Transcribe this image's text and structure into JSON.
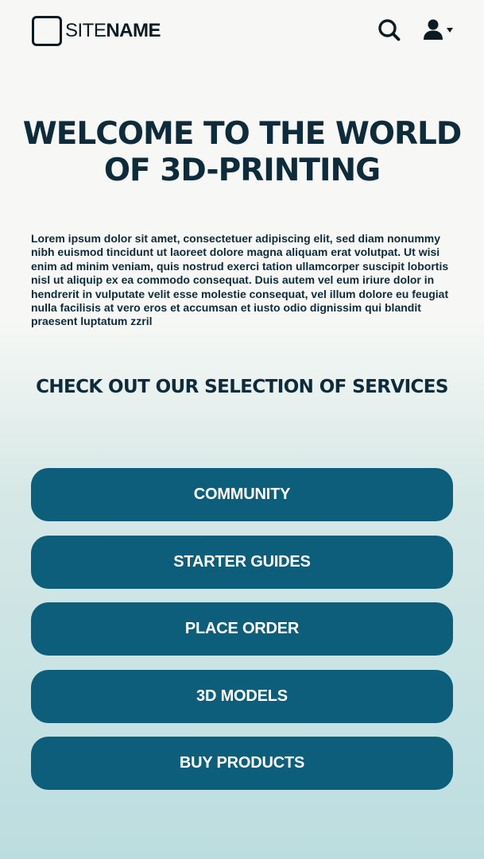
{
  "header": {
    "logo_light": "SITE",
    "logo_bold": "NAME",
    "search_icon": "search-icon",
    "user_icon": "user-icon",
    "dropdown_icon": "caret-down-icon"
  },
  "hero": {
    "title_line1": "WELCOME TO THE WORLD",
    "title_line2": "OF 3D-PRINTING",
    "intro": "Lorem ipsum dolor sit amet, consectetuer adipiscing elit, sed diam nonummy nibh euismod tincidunt ut laoreet dolore magna aliquam erat volutpat. Ut wisi enim ad minim veniam, quis nostrud exerci tation ullamcorper suscipit lobortis nisl ut aliquip ex ea commodo consequat. Duis autem vel eum iriure dolor in hendrerit in vulputate velit esse molestie consequat, vel illum dolore eu feugiat nulla facilisis at vero eros et accumsan et iusto odio dignissim qui blandit praesent luptatum zzril"
  },
  "services": {
    "title": "CHECK OUT OUR SELECTION OF SERVICES",
    "items": [
      {
        "label": "COMMUNITY"
      },
      {
        "label": "STARTER GUIDES"
      },
      {
        "label": "PLACE ORDER"
      },
      {
        "label": "3D MODELS"
      },
      {
        "label": "BUY PRODUCTS"
      }
    ]
  },
  "colors": {
    "primary": "#0c5e7b",
    "text_dark": "#0d2b3b",
    "background_top": "#f7f8f5",
    "background_bottom": "#bcdde0"
  }
}
